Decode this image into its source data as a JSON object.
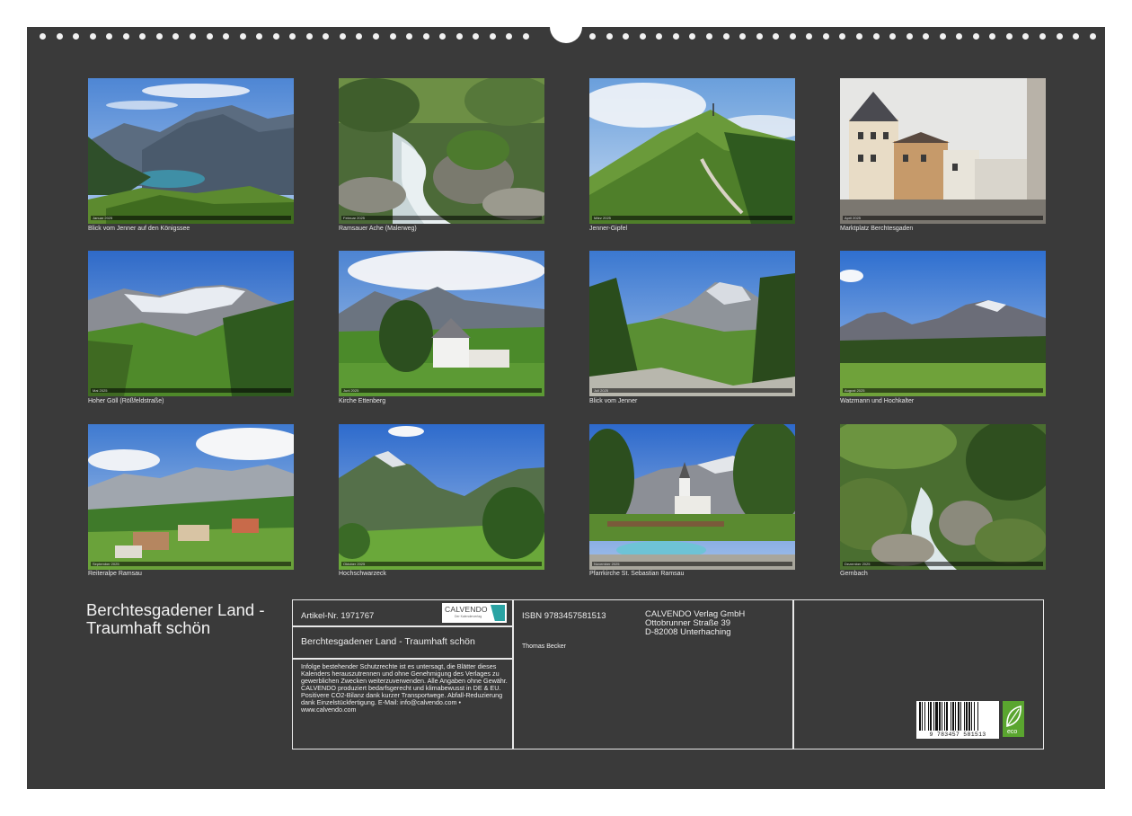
{
  "calendar": {
    "title": "Berchtesgadener Land - Traumhaft schön",
    "months": [
      {
        "caption": "Blick vom Jenner auf den Königssee",
        "strip_label": "Januar 2025"
      },
      {
        "caption": "Ramsauer Ache (Malerweg)",
        "strip_label": "Februar 2025"
      },
      {
        "caption": "Jenner-Gipfel",
        "strip_label": "März 2025"
      },
      {
        "caption": "Marktplatz Berchtesgaden",
        "strip_label": "April 2025"
      },
      {
        "caption": "Hoher Göll (Rößfeldstraße)",
        "strip_label": "Mai 2025"
      },
      {
        "caption": "Kirche Ettenberg",
        "strip_label": "Juni 2025"
      },
      {
        "caption": "Blick vom Jenner",
        "strip_label": "Juli 2025"
      },
      {
        "caption": "Watzmann und Hochkalter",
        "strip_label": "August 2025"
      },
      {
        "caption": "Reiteralpe Ramsau",
        "strip_label": "September 2025"
      },
      {
        "caption": "Hochschwarzeck",
        "strip_label": "Oktober 2025"
      },
      {
        "caption": "Pfarrkirche St. Sebastian Ramsau",
        "strip_label": "November 2025"
      },
      {
        "caption": "Gernbach",
        "strip_label": "Dezember 2025"
      }
    ]
  },
  "info": {
    "article": "Artikel-Nr. 1971767",
    "logo_text": "CALVENDO",
    "logo_sub": "Der Kalenderverlag",
    "subtitle": "Berchtesgadener Land - Traumhaft schön",
    "legal": "Infolge bestehender Schutzrechte ist es untersagt, die Blätter dieses Kalenders herauszutrennen und ohne Genehmigung des Verlages zu gewerblichen Zwecken weiterzuverwenden. Alle Angaben ohne Gewähr. CALVENDO produziert bedarfsgerecht und klimabewusst in DE & EU. Positivere CO2-Bilanz dank kurzer Transportwege. Abfall-Reduzierung dank Einzelstückfertigung. E-Mail: info@calvendo.com • www.calvendo.com",
    "isbn": "ISBN 9783457581513",
    "author": "Thomas Becker",
    "publisher_name": "CALVENDO Verlag GmbH",
    "publisher_street": "Ottobrunner Straße 39",
    "publisher_city": "D-82008 Unterhaching",
    "barcode_digits": "9 783457 581513",
    "eco_label": "eco"
  },
  "colors": {
    "sheet": "#3a3a3a",
    "border": "#e8e8e8",
    "accent_logo": "#2aa3a3",
    "eco": "#5aa52f"
  }
}
